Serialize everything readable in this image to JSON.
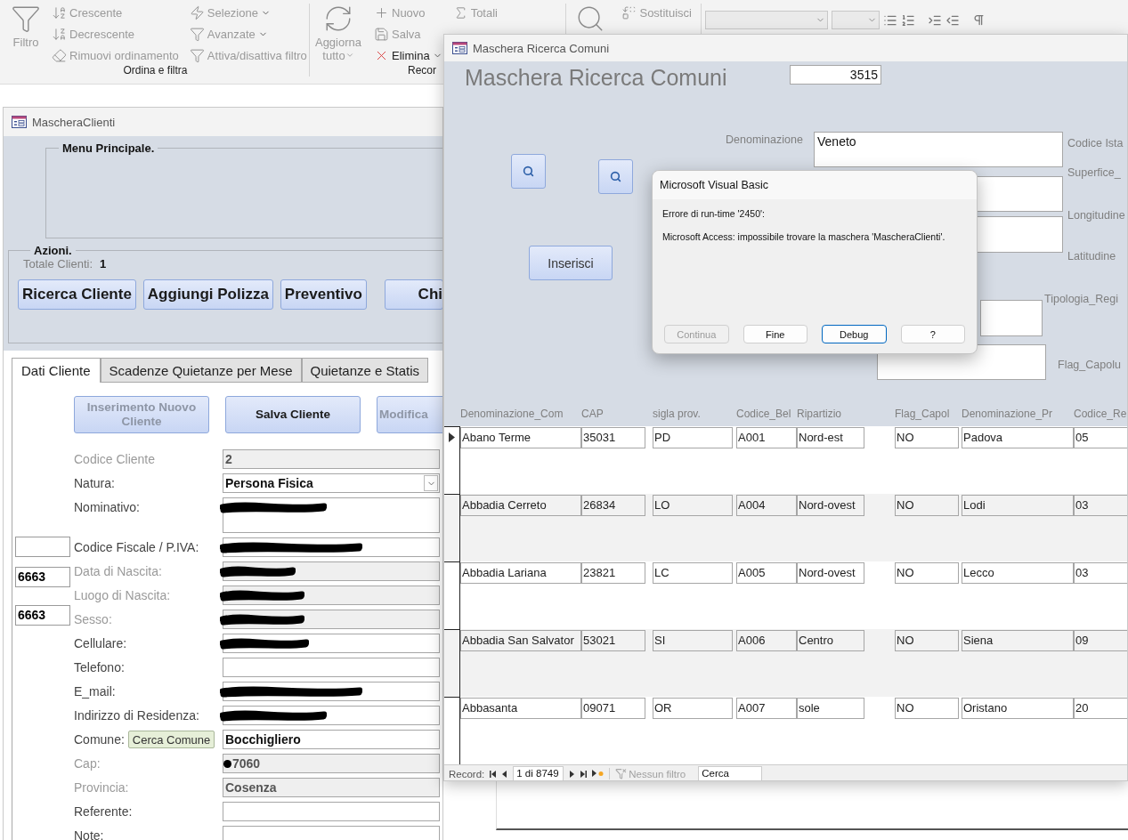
{
  "ribbon": {
    "groups": [
      {
        "label": "Ordina e filtra",
        "large": {
          "label": "Filtro",
          "disabled": true,
          "dropdown": false
        },
        "columns": [
          [
            {
              "label": "Crescente",
              "disabled": true,
              "dropdown": false
            },
            {
              "label": "Decrescente",
              "disabled": true,
              "dropdown": false
            },
            {
              "label": "Rimuovi ordinamento",
              "disabled": true,
              "dropdown": false
            }
          ],
          [
            {
              "label": "Selezione",
              "disabled": true,
              "dropdown": true
            },
            {
              "label": "Avanzate",
              "disabled": true,
              "dropdown": true
            },
            {
              "label": "Attiva/disattiva filtro",
              "disabled": true,
              "dropdown": false
            }
          ]
        ]
      },
      {
        "label": "Recor",
        "large": {
          "label": "Aggiorna tutto",
          "disabled": true,
          "dropdown": true
        },
        "columns": [
          [
            {
              "label": "Nuovo",
              "disabled": true,
              "dropdown": false
            },
            {
              "label": "Salva",
              "disabled": true,
              "dropdown": false
            },
            {
              "label": "Elimina",
              "disabled": false,
              "dropdown": true
            }
          ],
          [
            {
              "label": "Totali",
              "disabled": true,
              "dropdown": false
            }
          ]
        ]
      },
      {
        "large": {
          "disabled": true
        },
        "columns": [
          [
            {
              "label": "Sostituisci",
              "disabled": true,
              "dropdown": false
            }
          ]
        ]
      }
    ]
  },
  "clients_form": {
    "title": "MascheraClienti",
    "menu_frame": "Menu Principale.",
    "actions_frame": "Azioni.",
    "total_label": "Totale Clienti:",
    "total_value": "1",
    "action_buttons": [
      "Ricerca Cliente",
      "Aggiungi Polizza",
      "Preventivo",
      "Chi"
    ],
    "tabs": [
      {
        "label": "Dati Cliente",
        "selected": true
      },
      {
        "label": "Scadenze Quietanze per Mese",
        "selected": false
      },
      {
        "label": "Quietanze e Statis",
        "selected": false
      }
    ],
    "form_buttons": [
      {
        "label": "Inserimento Nuovo Cliente",
        "disabled": true
      },
      {
        "label": "Salva Cliente",
        "disabled": false
      },
      {
        "label": "Modifica",
        "disabled": true
      }
    ],
    "fields": [
      {
        "kind": "text",
        "label": "Codice Cliente",
        "value": "2",
        "locked": true,
        "masked": false,
        "dot_mark": false
      },
      {
        "kind": "combo",
        "label": "Natura:",
        "value": "Persona Fisica",
        "locked": false,
        "masked": false,
        "dot_mark": false
      },
      {
        "kind": "memo",
        "label": "Nominativo:",
        "locked": false,
        "masked": true,
        "dot_mark": false
      },
      {
        "kind": "text",
        "label": "Codice Fiscale / P.IVA:",
        "locked": false,
        "masked": true,
        "dot_mark": false,
        "side_box": {
          "kind": "blank"
        }
      },
      {
        "kind": "text",
        "label": "Data di Nascita:",
        "locked": true,
        "masked": true,
        "dot_mark": false,
        "side_box": {
          "kind": "filled",
          "value": "6663"
        }
      },
      {
        "kind": "text",
        "label": "Luogo di Nascita:",
        "locked": true,
        "masked": true,
        "dot_mark": false
      },
      {
        "kind": "text",
        "label": "Sesso:",
        "locked": true,
        "masked": true,
        "dot_mark": false,
        "side_box": {
          "kind": "filled",
          "value": "6663"
        }
      },
      {
        "kind": "text",
        "label": "Cellulare:",
        "locked": false,
        "masked": true,
        "dot_mark": false
      },
      {
        "kind": "text",
        "label": "Telefono:",
        "locked": false,
        "masked": false,
        "dot_mark": false
      },
      {
        "kind": "text",
        "label": "E_mail:",
        "locked": false,
        "masked": true,
        "dot_mark": false
      },
      {
        "kind": "text",
        "label": "Indirizzo di Residenza:",
        "locked": false,
        "masked": true,
        "dot_mark": false
      },
      {
        "kind": "text",
        "label": "Comune:",
        "value": "Bocchigliero",
        "locked": false,
        "button": "Cerca Comune",
        "masked": false,
        "dot_mark": false
      },
      {
        "kind": "text",
        "label": "Cap:",
        "value": "7060",
        "locked": true,
        "masked": false,
        "dot_mark": true
      },
      {
        "kind": "text",
        "label": "Provincia:",
        "value": "Cosenza",
        "locked": true,
        "masked": false,
        "dot_mark": false
      },
      {
        "kind": "text",
        "label": "Referente:",
        "locked": false,
        "masked": false,
        "dot_mark": false
      },
      {
        "kind": "memo",
        "label": "Note:",
        "locked": false,
        "masked": false,
        "dot_mark": false
      }
    ]
  },
  "search_form": {
    "title": "Maschera Ricerca Comuni",
    "heading": "Maschera Ricerca Comuni",
    "counter": "3515",
    "insert_button": "Inserisci",
    "denominazione": {
      "label": "Denominazione",
      "value": "Veneto"
    },
    "side_labels": [
      "Codice Ista",
      "Superfice_",
      "Longitudine",
      "Latitudine",
      "Tipologia_Regi",
      "Flag_Capolu"
    ],
    "columns": [
      "Denominazione_Com",
      "CAP",
      "sigla prov.",
      "Codice_Bel",
      "Ripartizio",
      "Flag_Capol",
      "Denominazione_Pr",
      "Codice_Re"
    ],
    "rows": [
      {
        "current": true,
        "cells": [
          "Abano Terme",
          "35031",
          "PD",
          "A001",
          "Nord-est",
          "NO",
          "Padova",
          "05"
        ]
      },
      {
        "current": false,
        "cells": [
          "Abbadia Cerreto",
          "26834",
          "LO",
          "A004",
          "Nord-ovest",
          "NO",
          "Lodi",
          "03"
        ]
      },
      {
        "current": false,
        "cells": [
          "Abbadia Lariana",
          "23821",
          "LC",
          "A005",
          "Nord-ovest",
          "NO",
          "Lecco",
          "03"
        ]
      },
      {
        "current": false,
        "cells": [
          "Abbadia San Salvator",
          "53021",
          "SI",
          "A006",
          "Centro",
          "NO",
          "Siena",
          "09"
        ]
      },
      {
        "current": false,
        "cells": [
          "Abbasanta",
          "09071",
          "OR",
          "A007",
          "sole",
          "NO",
          "Oristano",
          "20"
        ]
      }
    ],
    "navigator": {
      "label": "Record:",
      "position": "1 di 8749",
      "filter": "Nessun filtro",
      "search": "Cerca"
    }
  },
  "dialog": {
    "title": "Microsoft Visual Basic",
    "lines": [
      "Errore di run-time '2450':",
      "Microsoft Access: impossibile trovare la maschera 'MascheraClienti'."
    ],
    "buttons": [
      {
        "label": "Continua",
        "disabled": true,
        "default": false
      },
      {
        "label": "Fine",
        "disabled": false,
        "default": false
      },
      {
        "label": "Debug",
        "disabled": false,
        "default": true
      },
      {
        "label": "?",
        "disabled": false,
        "default": false
      }
    ]
  }
}
